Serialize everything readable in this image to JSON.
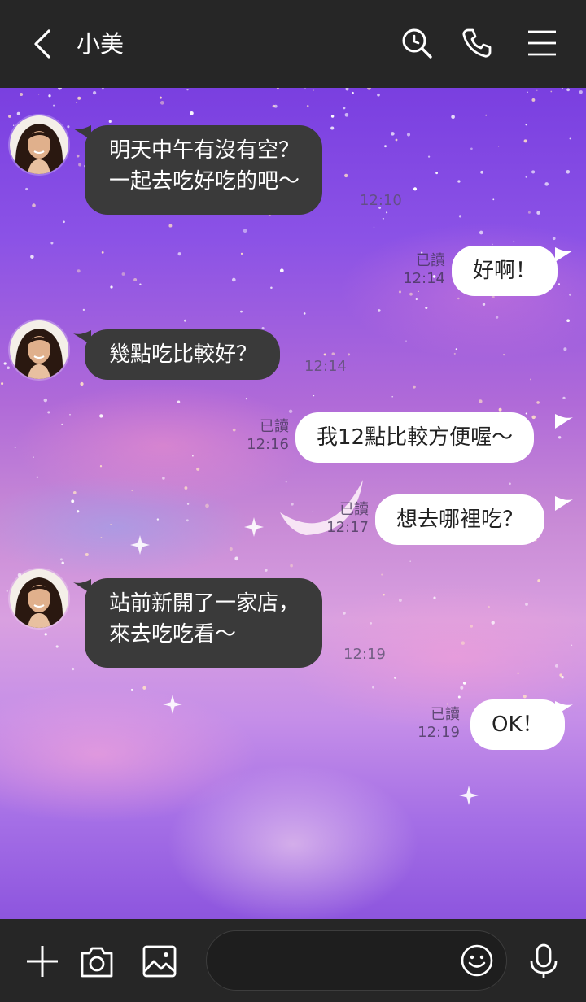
{
  "header": {
    "title": "小美"
  },
  "messages": [
    {
      "side": "in",
      "text": "明天中午有沒有空？\n一起去吃好吃的吧～",
      "time": "12:10"
    },
    {
      "side": "out",
      "text": "好啊！",
      "time": "12:14",
      "read": "已讀"
    },
    {
      "side": "in",
      "text": "幾點吃比較好？",
      "time": "12:14"
    },
    {
      "side": "out",
      "text": "我12點比較方便喔～",
      "time": "12:16",
      "read": "已讀"
    },
    {
      "side": "out",
      "text": "想去哪裡吃？",
      "time": "12:17",
      "read": "已讀"
    },
    {
      "side": "in",
      "text": "站前新開了一家店，\n來去吃吃看～",
      "time": "12:19"
    },
    {
      "side": "out",
      "text": "OK！",
      "time": "12:19",
      "read": "已讀"
    }
  ],
  "input": {
    "placeholder": ""
  },
  "icons": {
    "back": "chevron-left-icon",
    "search": "search-icon",
    "call": "phone-icon",
    "menu": "menu-icon",
    "add": "plus-icon",
    "camera": "camera-icon",
    "image": "image-icon",
    "emoji": "emoji-icon",
    "mic": "microphone-icon"
  },
  "colors": {
    "header_bg": "#262626",
    "incoming_bubble": "#3a3a3a",
    "outgoing_bubble": "#ffffff"
  }
}
